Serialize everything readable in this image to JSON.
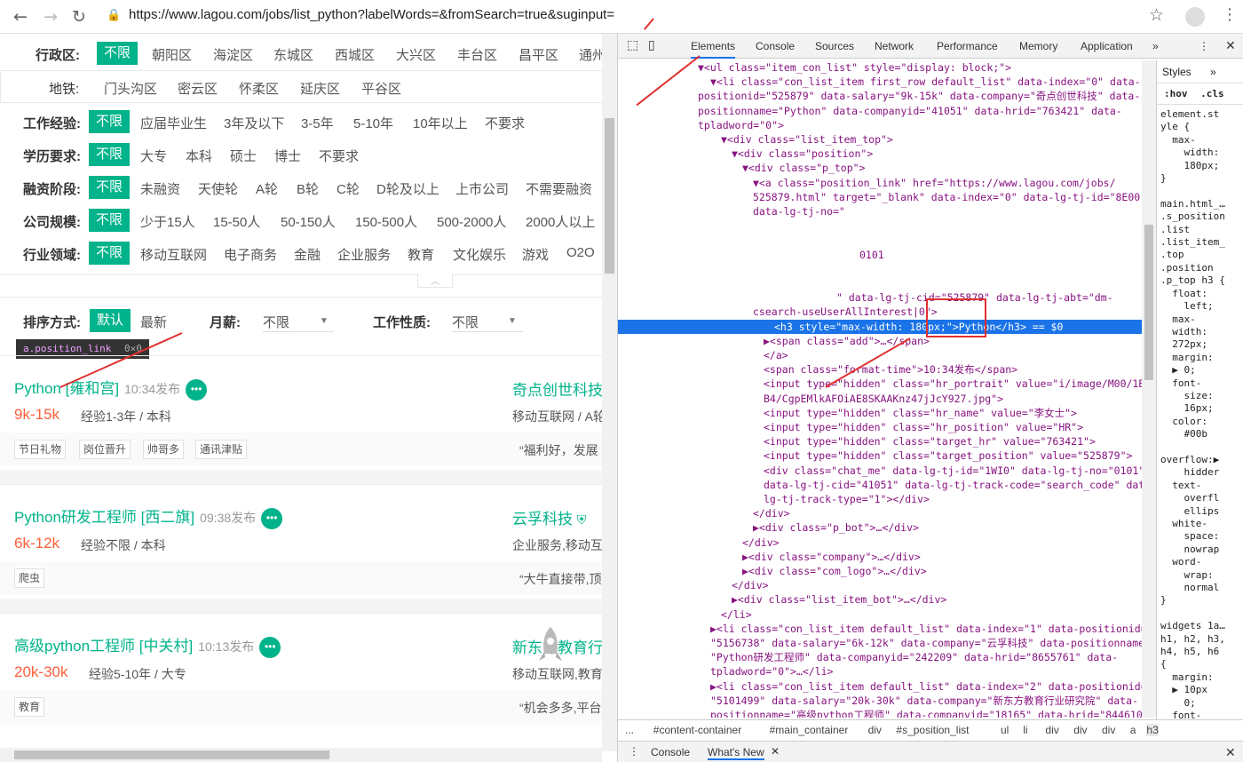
{
  "browser": {
    "url": "https://www.lagou.com/jobs/list_python?labelWords=&fromSearch=true&suginput="
  },
  "filters": {
    "district": {
      "label": "行政区:",
      "selected": "不限",
      "options": [
        "朝阳区",
        "海淀区",
        "东城区",
        "西城区",
        "大兴区",
        "丰台区",
        "昌平区",
        "通州"
      ]
    },
    "subway": {
      "label": "地铁:",
      "options": [
        "门头沟区",
        "密云区",
        "怀柔区",
        "延庆区",
        "平谷区"
      ]
    },
    "experience": {
      "label": "工作经验:",
      "selected": "不限",
      "options": [
        "应届毕业生",
        "3年及以下",
        "3-5年",
        "5-10年",
        "10年以上",
        "不要求"
      ]
    },
    "education": {
      "label": "学历要求:",
      "selected": "不限",
      "options": [
        "大专",
        "本科",
        "硕士",
        "博士",
        "不要求"
      ]
    },
    "funding": {
      "label": "融资阶段:",
      "selected": "不限",
      "options": [
        "未融资",
        "天使轮",
        "A轮",
        "B轮",
        "C轮",
        "D轮及以上",
        "上市公司",
        "不需要融资"
      ]
    },
    "size": {
      "label": "公司规模:",
      "selected": "不限",
      "options": [
        "少于15人",
        "15-50人",
        "50-150人",
        "150-500人",
        "500-2000人",
        "2000人以上"
      ]
    },
    "industry": {
      "label": "行业领域:",
      "selected": "不限",
      "options": [
        "移动互联网",
        "电子商务",
        "金融",
        "企业服务",
        "教育",
        "文化娱乐",
        "游戏",
        "O2O"
      ]
    }
  },
  "sort": {
    "label": "排序方式:",
    "selected": "默认",
    "other": "最新",
    "salary_label": "月薪:",
    "salary_value": "不限",
    "type_label": "工作性质:",
    "type_value": "不限"
  },
  "tooltip": {
    "selector": "a.position_link",
    "size": "0×0"
  },
  "jobs": [
    {
      "title": "Python [雍和宫]",
      "time": "10:34发布",
      "salary": "9k-15k",
      "exp": "经验1-3年 / 本科",
      "company": "奇点创世科技",
      "industry": "移动互联网 / A轮",
      "tags": [
        "节日礼物",
        "岗位晋升",
        "帅哥多",
        "通讯津贴"
      ],
      "quote": "“福利好，发展"
    },
    {
      "title": "Python研发工程师 [西二旗]",
      "time": "09:38发布",
      "salary": "6k-12k",
      "exp": "经验不限 / 本科",
      "company": "云孚科技",
      "industry": "企业服务,移动互",
      "tags": [
        "爬虫"
      ],
      "quote": "“大牛直接带,顶"
    },
    {
      "title": "高级python工程师 [中关村]",
      "time": "10:13发布",
      "salary": "20k-30k",
      "exp": "经验5-10年 / 大专",
      "company": "新东方教育行",
      "industry": "移动互联网,教育",
      "tags": [
        "教育"
      ],
      "quote": "“机会多多,平台"
    }
  ],
  "devtools": {
    "tabs": [
      "Elements",
      "Console",
      "Sources",
      "Network",
      "Performance",
      "Memory",
      "Application"
    ],
    "styles_tab": "Styles",
    "hov": ":hov",
    "cls": ".cls",
    "code_lines": [
      "▼<ul class=\"item_con_list\" style=\"display: block;\">",
      "▼<li class=\"con_list_item first_row default_list\" data-index=\"0\" data-",
      "positionid=\"525879\" data-salary=\"9k-15k\" data-company=\"奇点创世科技\" data-",
      "positionname=\"Python\" data-companyid=\"41051\" data-hrid=\"763421\" data-",
      "tpladword=\"0\">",
      "▼<div class=\"list_item_top\">",
      "▼<div class=\"position\">",
      "▼<div class=\"p_top\">",
      "▼<a class=\"position_link\" href=\"https://www.lagou.com/jobs/",
      "525879.html\" target=\"_blank\" data-index=\"0\" data-lg-tj-id=\"8E00\"",
      "data-lg-tj-no=\"",
      "",
      "",
      "0101",
      "",
      "",
      "\" data-lg-tj-cid=\"525879\" data-lg-tj-abt=\"dm-",
      "csearch-useUserAllInterest|0\">",
      "<h3 style=\"max-width: 180px;\">Python</h3> == $0",
      "▶<span class=\"add\">…</span>",
      "</a>",
      "<span class=\"format-time\">10:34发布</span>",
      "<input type=\"hidden\" class=\"hr_portrait\" value=\"i/image/M00/1B/",
      "B4/CgpEMlkAFOiAE8SKAAKnz47jJcY927.jpg\">",
      "<input type=\"hidden\" class=\"hr_name\" value=\"李女士\">",
      "<input type=\"hidden\" class=\"hr_position\" value=\"HR\">",
      "<input type=\"hidden\" class=\"target_hr\" value=\"763421\">",
      "<input type=\"hidden\" class=\"target_position\" value=\"525879\">",
      "<div class=\"chat_me\" data-lg-tj-id=\"1WI0\" data-lg-tj-no=\"0101\"",
      "data-lg-tj-cid=\"41051\" data-lg-tj-track-code=\"search_code\" data-",
      "lg-tj-track-type=\"1\"></div>",
      "</div>",
      "▶<div class=\"p_bot\">…</div>",
      "</div>",
      "▶<div class=\"company\">…</div>",
      "▶<div class=\"com_logo\">…</div>",
      "</div>",
      "▶<div class=\"list_item_bot\">…</div>",
      "</li>",
      "▶<li class=\"con_list_item default_list\" data-index=\"1\" data-positionid=",
      "\"5156738\" data-salary=\"6k-12k\" data-company=\"云孚科技\" data-positionname=",
      "\"Python研发工程师\" data-companyid=\"242209\" data-hrid=\"8655761\" data-",
      "tpladword=\"0\">…</li>",
      "▶<li class=\"con_list_item default_list\" data-index=\"2\" data-positionid=",
      "\"5101499\" data-salary=\"20k-30k\" data-company=\"新东方教育行业研究院\" data-",
      "positionname=\"高级python工程师\" data-companyid=\"18165\" data-hrid=\"8446100\" data-"
    ],
    "styles_lines": [
      "element.st",
      "yle {",
      "  max-",
      "    width:",
      "    180px;",
      "}",
      "",
      "main.html_…",
      ".s_position",
      ".list",
      ".list_item_",
      ".top",
      ".position",
      ".p_top h3 {",
      "  float:",
      "    left;",
      "  max-",
      "  width:",
      "  272px;",
      "  margin:",
      "  ▶ 0;",
      "  font-",
      "    size:",
      "    16px;",
      "  color:",
      "    #00b",
      "",
      "overflow:▶",
      "    hidder",
      "  text-",
      "    overfl",
      "    ellips",
      "  white-",
      "    space:",
      "    nowrap",
      "  word-",
      "    wrap:",
      "    normal",
      "}",
      "",
      "widgets 1a…",
      "h1, h2, h3,",
      "h4, h5, h6",
      "{",
      "  margin:",
      "  ▶ 10px",
      "    0;",
      "  font-",
      "    weight",
      "    400;"
    ],
    "breadcrumbs": [
      "...",
      "#content-container",
      "#main_container",
      "div",
      "#s_position_list",
      "ul",
      "li",
      "div",
      "div",
      "div",
      "a",
      "h3"
    ],
    "drawer": {
      "console": "Console",
      "whatsnew": "What's New"
    }
  }
}
